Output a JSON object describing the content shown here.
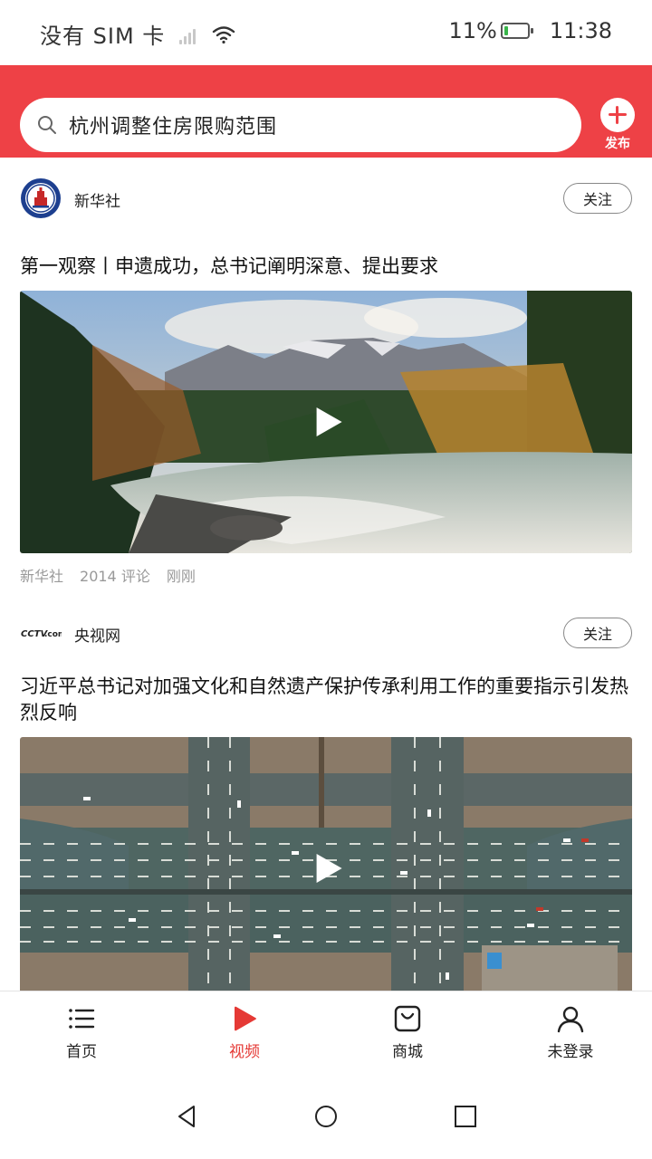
{
  "status_bar": {
    "carrier": "没有 SIM 卡",
    "battery": "11%",
    "time": "11:38"
  },
  "search": {
    "query": "杭州调整住房限购范围"
  },
  "publish": {
    "label": "发布"
  },
  "feed": [
    {
      "source": "新华社",
      "follow_label": "关注",
      "title": "第一观察丨申遗成功，总书记阐明深意、提出要求",
      "meta": {
        "source": "新华社",
        "comments": "2014 评论",
        "time": "刚刚"
      }
    },
    {
      "source": "央视网",
      "follow_label": "关注",
      "title": "习近平总书记对加强文化和自然遗产保护传承利用工作的重要指示引发热烈反响"
    }
  ],
  "bottom_nav": {
    "items": [
      {
        "label": "首页",
        "icon": "list-icon"
      },
      {
        "label": "视频",
        "icon": "play-icon",
        "active": true
      },
      {
        "label": "商城",
        "icon": "shopping-bag-icon"
      },
      {
        "label": "未登录",
        "icon": "user-icon"
      }
    ]
  },
  "colors": {
    "brand_red": "#ee4146",
    "active_tab": "#e53935"
  }
}
